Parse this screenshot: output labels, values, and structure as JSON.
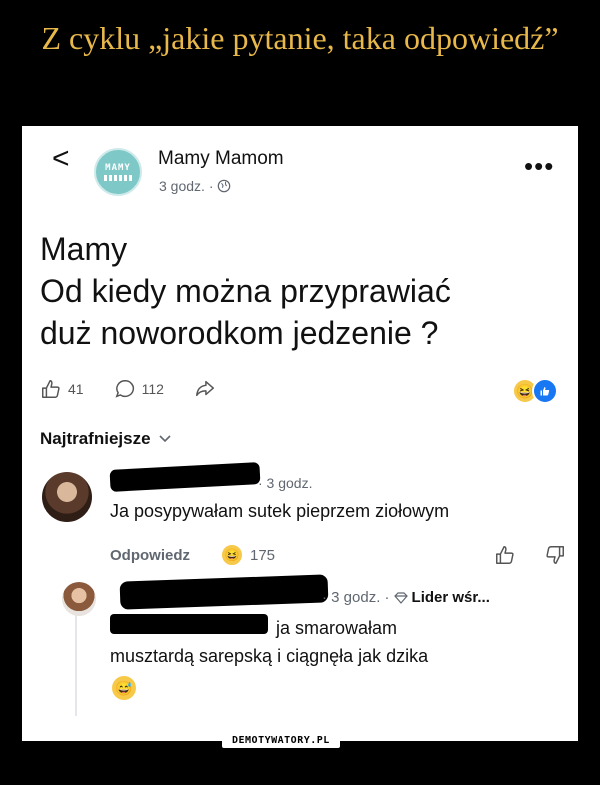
{
  "meme_title": "Z cyklu „jakie pytanie, taka odpowiedź”",
  "post": {
    "back_glyph": "<",
    "avatar_text": "MAMY",
    "author": "Mamy Mamom",
    "time": "3 godz. ·",
    "more_glyph": "•••",
    "text": "Mamy\nOd kiedy można przyprawiać\nduż noworodkom jedzenie ?",
    "likes": "41",
    "comments": "112",
    "reaction_icons": [
      "haha-emoji",
      "like-icon"
    ]
  },
  "sort_label": "Najtrafniejsze",
  "comment": {
    "time": "· 3 godz.",
    "text": "Ja posypywałam sutek pieprzem ziołowym",
    "reply_label": "Odpowiedz",
    "reaction_count": "175"
  },
  "reply": {
    "meta_time": "· 3 godz. ·",
    "badge": "Lider wśr...",
    "text": "ja smarowałam\nmusztardą sarepską i ciągnęła jak dzika"
  },
  "watermark": "DEMOTYWATORY.PL",
  "colors": {
    "title": "#e8b84a",
    "meta": "#606770",
    "like_blue": "#1877f2"
  }
}
